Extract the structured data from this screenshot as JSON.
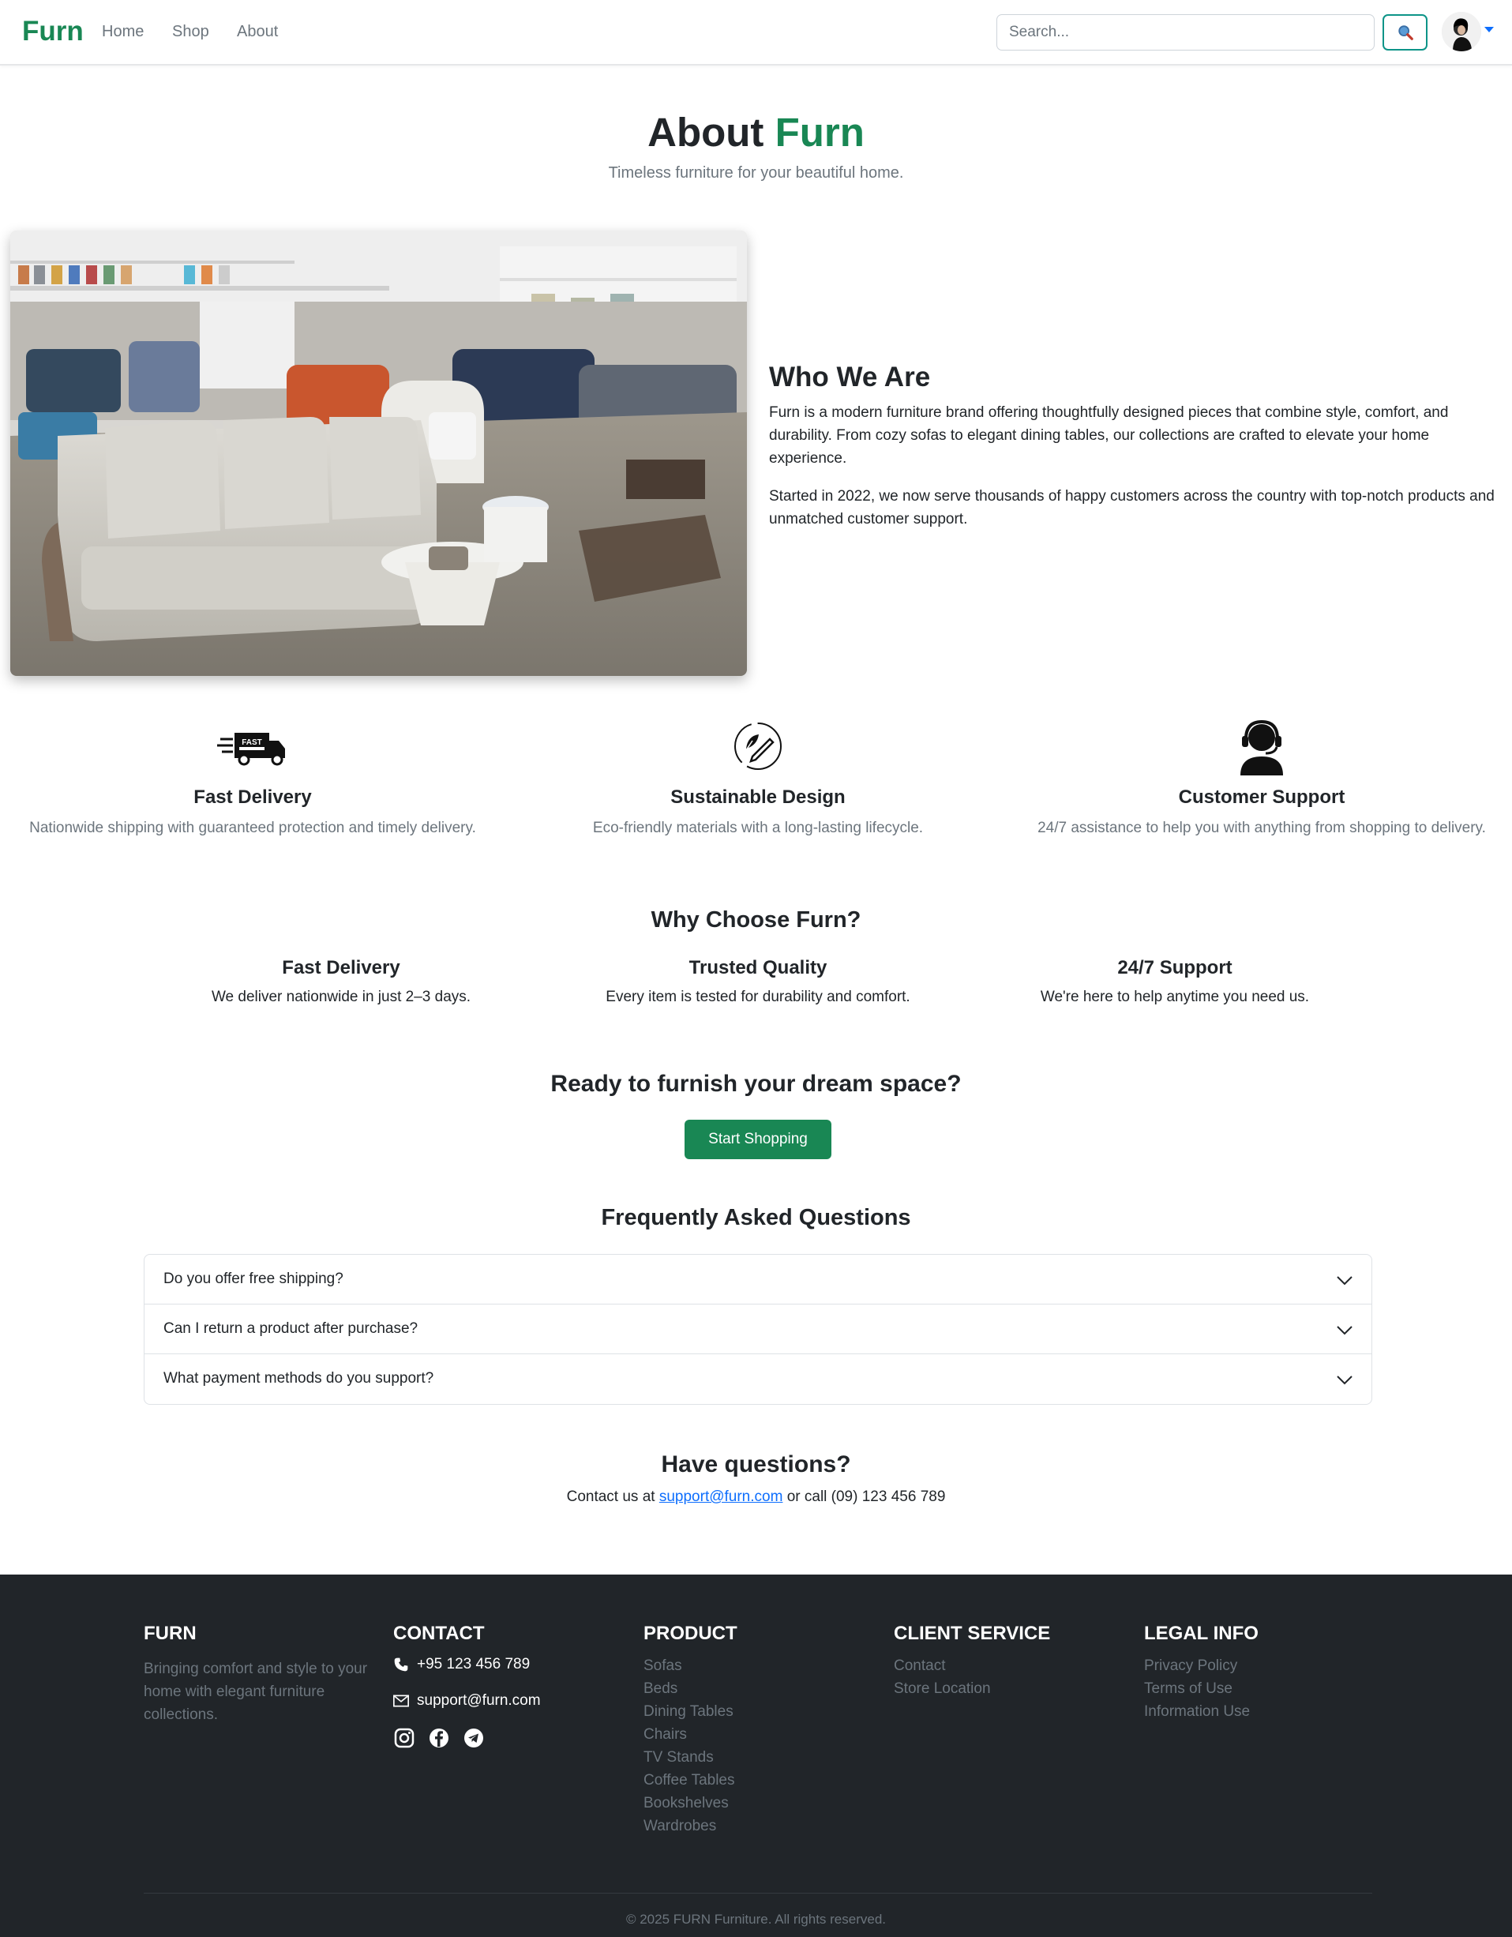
{
  "nav": {
    "brand": "Furn",
    "links": [
      "Home",
      "Shop",
      "About"
    ],
    "search_placeholder": "Search...",
    "accent": "#198754"
  },
  "hero": {
    "title_main": "About",
    "title_accent": "Furn",
    "subtitle": "Timeless furniture for your beautiful home."
  },
  "who": {
    "title": "Who We Are",
    "p1": "Furn is a modern furniture brand offering thoughtfully designed pieces that combine style, comfort, and durability. From cozy sofas to elegant dining tables, our collections are crafted to elevate your home experience.",
    "p2": "Started in 2022, we now serve thousands of happy customers across the country with top-notch products and unmatched customer support.",
    "image_icon": "furniture-showroom-photo"
  },
  "features": [
    {
      "icon": "fast-delivery-truck-icon",
      "title": "Fast Delivery",
      "text": "Nationwide shipping with guaranteed protection and timely delivery."
    },
    {
      "icon": "eco-leaf-pencil-icon",
      "title": "Sustainable Design",
      "text": "Eco-friendly materials with a long-lasting lifecycle."
    },
    {
      "icon": "headset-support-icon",
      "title": "Customer Support",
      "text": "24/7 assistance to help you with anything from shopping to delivery."
    }
  ],
  "truck_badge": "FAST",
  "why": {
    "title": "Why Choose Furn?",
    "items": [
      {
        "title": "Fast Delivery",
        "text": "We deliver nationwide in just 2–3 days."
      },
      {
        "title": "Trusted Quality",
        "text": "Every item is tested for durability and comfort."
      },
      {
        "title": "24/7 Support",
        "text": "We're here to help anytime you need us."
      }
    ]
  },
  "cta": {
    "title": "Ready to furnish your dream space?",
    "button": "Start Shopping"
  },
  "faq": {
    "title": "Frequently Asked Questions",
    "items": [
      "Do you offer free shipping?",
      "Can I return a product after purchase?",
      "What payment methods do you support?"
    ]
  },
  "contact": {
    "title": "Have questions?",
    "prefix": "Contact us at ",
    "email": "support@furn.com",
    "suffix": " or call (09) 123 456 789"
  },
  "footer": {
    "brand_head": "FURN",
    "brand_desc": "Bringing comfort and style to your home with elegant furniture collections.",
    "contact_head": "CONTACT",
    "phone": "+95 123 456 789",
    "email": "support@furn.com",
    "socials": [
      "instagram-icon",
      "facebook-icon",
      "telegram-icon"
    ],
    "product_head": "PRODUCT",
    "products": [
      "Sofas",
      "Beds",
      "Dining Tables",
      "Chairs",
      "TV Stands",
      "Coffee Tables",
      "Bookshelves",
      "Wardrobes"
    ],
    "service_head": "CLIENT SERVICE",
    "services": [
      "Contact",
      "Store Location"
    ],
    "legal_head": "LEGAL INFO",
    "legal": [
      "Privacy Policy",
      "Terms of Use",
      "Information Use"
    ],
    "copyright": "© 2025 FURN Furniture. All rights reserved."
  }
}
